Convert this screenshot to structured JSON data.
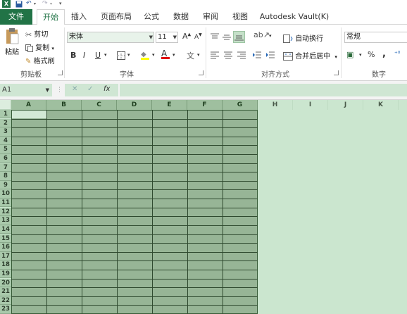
{
  "qat": {
    "undo": "↶",
    "redo": "↷",
    "customize": "▾"
  },
  "tabs": [
    {
      "label": "文件"
    },
    {
      "label": "开始"
    },
    {
      "label": "插入"
    },
    {
      "label": "页面布局"
    },
    {
      "label": "公式"
    },
    {
      "label": "数据"
    },
    {
      "label": "审阅"
    },
    {
      "label": "视图"
    },
    {
      "label": "Autodesk Vault(K)"
    }
  ],
  "clipboard": {
    "paste": "粘贴",
    "cut": "剪切",
    "copy": "复制",
    "format_painter": "格式刷",
    "group": "剪贴板"
  },
  "font": {
    "name": "宋体",
    "size": "11",
    "grow": "A",
    "shrink": "A",
    "bold": "B",
    "italic": "I",
    "underline": "U",
    "color_glyph": "A",
    "fill_glyph": "◆",
    "pinyin": "文",
    "group": "字体"
  },
  "alignment": {
    "wrap": "自动换行",
    "merge": "合并后居中",
    "group": "对齐方式"
  },
  "number": {
    "format": "常规",
    "percent": "%",
    "comma": ",",
    "group": "数字"
  },
  "formula_bar": {
    "namebox": "A1",
    "cancel": "✕",
    "enter": "✓",
    "fx": "fx",
    "value": ""
  },
  "columns": [
    "A",
    "B",
    "C",
    "D",
    "E",
    "F",
    "G",
    "H",
    "I",
    "J",
    "K"
  ],
  "rows": [
    "1",
    "2",
    "3",
    "4",
    "5",
    "6",
    "7",
    "8",
    "9",
    "10",
    "11",
    "12",
    "13",
    "14",
    "15",
    "16",
    "17",
    "18",
    "19",
    "20",
    "21",
    "22",
    "23"
  ],
  "colors": {
    "brand": "#217346",
    "selection_fill": "#97b596",
    "sheet_bg": "#cbe6cf"
  }
}
